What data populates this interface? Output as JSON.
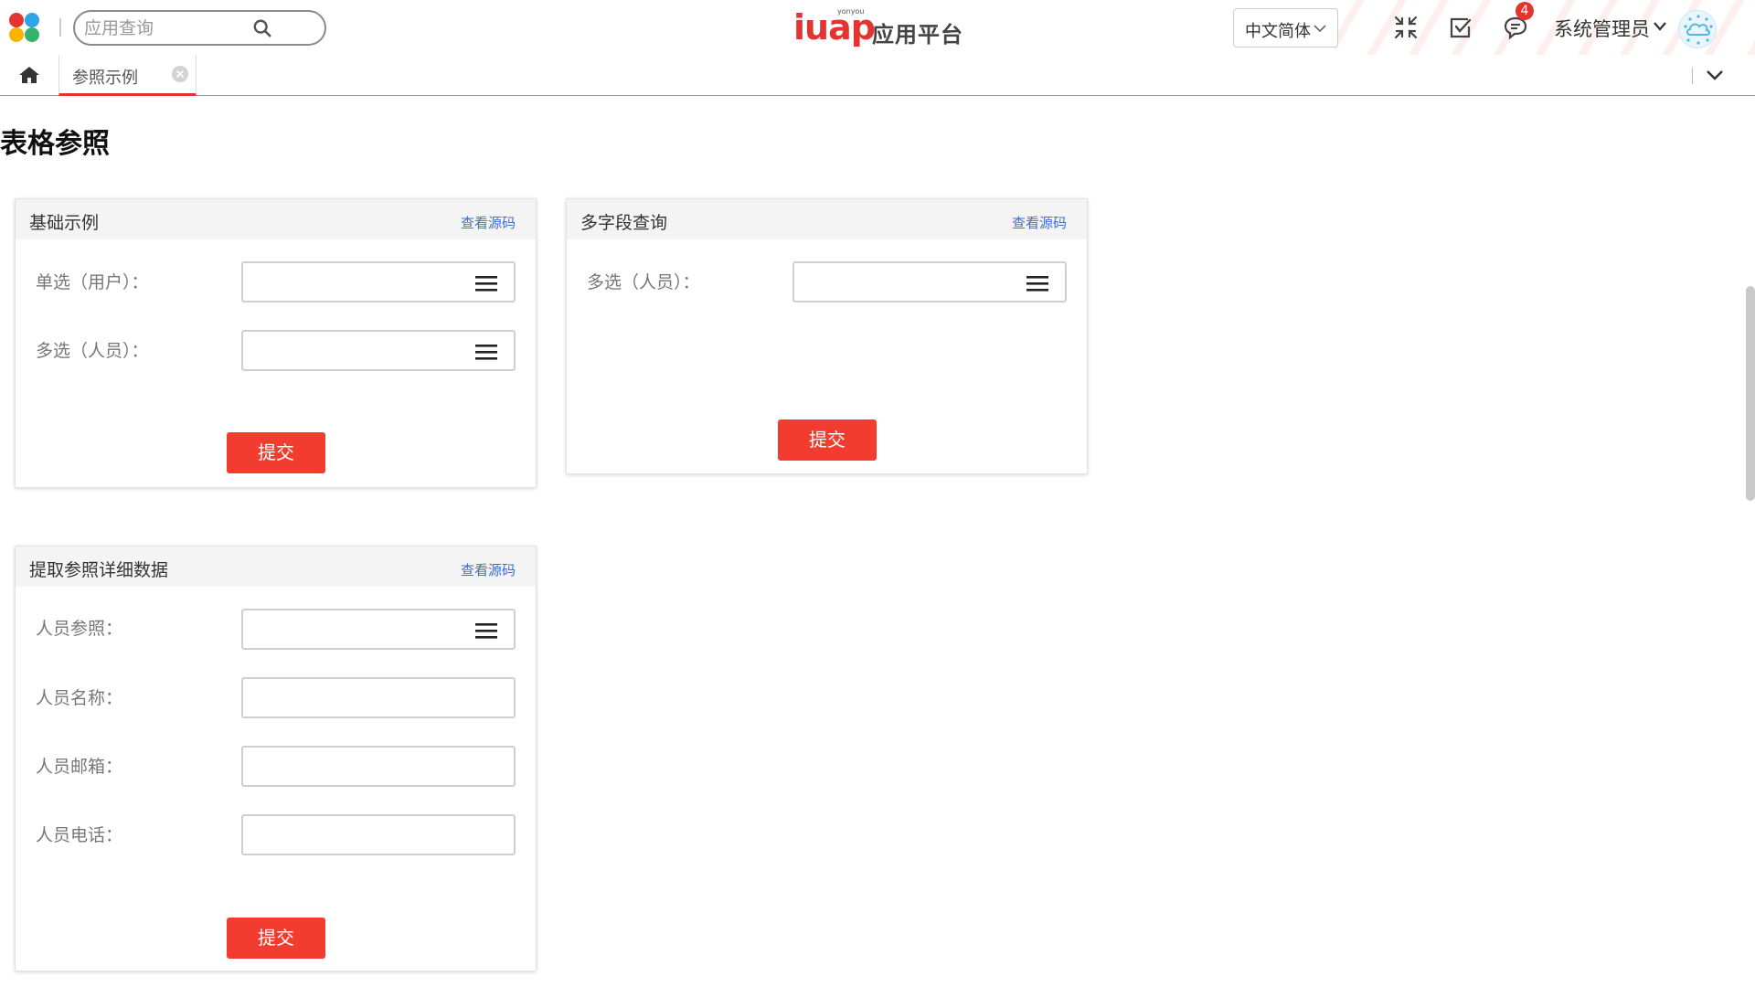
{
  "header": {
    "search_placeholder": "应用查询",
    "logo_small": "yonyou",
    "logo_main": "iuap",
    "logo_platform": "应用平台",
    "language": "中文简体",
    "notification_count": "4",
    "user_name": "系统管理员"
  },
  "tabs": {
    "active_label": "参照示例"
  },
  "page": {
    "title": "表格参照"
  },
  "cards": {
    "basic": {
      "title": "基础示例",
      "link": "查看源码",
      "fields": [
        "单选（用户）：",
        "多选（人员）："
      ],
      "submit": "提交"
    },
    "multi": {
      "title": "多字段查询",
      "link": "查看源码",
      "fields": [
        "多选（人员）："
      ],
      "submit": "提交"
    },
    "detail": {
      "title": "提取参照详细数据",
      "link": "查看源码",
      "fields": [
        "人员参照：",
        "人员名称：",
        "人员邮箱：",
        "人员电话："
      ],
      "submit": "提交"
    }
  },
  "colors": {
    "accent": "#f23c2f",
    "link": "#3a6fd8",
    "app_grid": [
      "#e3342f",
      "#2fa3e8",
      "#f7b500",
      "#36b36a"
    ]
  },
  "icons": {
    "apps": "app-grid-icon",
    "search": "search-icon",
    "collapse": "collapse-icon",
    "tasks": "checklist-icon",
    "messages": "message-icon",
    "home": "home-icon",
    "tab_close": "close-icon",
    "tab_more": "chevron-down-icon",
    "ref_picker": "menu-icon"
  }
}
